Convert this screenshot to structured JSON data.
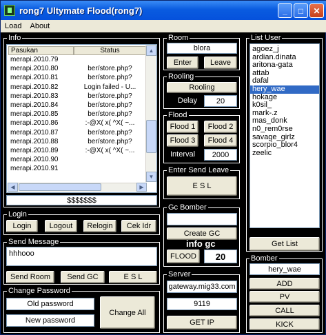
{
  "window": {
    "title": "rong7 Ultymate Flood(rong7)"
  },
  "menu": [
    "Load",
    "About"
  ],
  "info": {
    "label": "Info",
    "columns": [
      "Pasukan",
      "Status"
    ],
    "rows": [
      {
        "pasukan": "merapi.2010.79",
        "status": ""
      },
      {
        "pasukan": "merapi.2010.80",
        "status": "ber/store.php?"
      },
      {
        "pasukan": "merapi.2010.81",
        "status": "ber/store.php?"
      },
      {
        "pasukan": "merapi.2010.82",
        "status": "Login failed - U..."
      },
      {
        "pasukan": "merapi.2010.83",
        "status": "ber/store.php?"
      },
      {
        "pasukan": "merapi.2010.84",
        "status": "ber/store.php?"
      },
      {
        "pasukan": "merapi.2010.85",
        "status": "ber/store.php?"
      },
      {
        "pasukan": "merapi.2010.86",
        "status": ":-@X( x( ^X( ~..."
      },
      {
        "pasukan": "merapi.2010.87",
        "status": "ber/store.php?"
      },
      {
        "pasukan": "merapi.2010.88",
        "status": "ber/store.php?"
      },
      {
        "pasukan": "merapi.2010.89",
        "status": ":-@X( x( ^X( ~..."
      },
      {
        "pasukan": "merapi.2010.90",
        "status": ""
      },
      {
        "pasukan": "merapi.2010.91",
        "status": ""
      }
    ],
    "footer": "$$$$$$$"
  },
  "login": {
    "label": "Login",
    "buttons": [
      "Login",
      "Logout",
      "Relogin",
      "Cek Idr"
    ]
  },
  "send_message": {
    "label": "Send Message",
    "text": "hhhooo",
    "buttons": [
      "Send Room",
      "Send GC",
      "E S L"
    ]
  },
  "change_password": {
    "label": "Change Password",
    "old_placeholder": "Old password",
    "new_placeholder": "New password",
    "change_all": "Change All"
  },
  "room": {
    "label": "Room",
    "value": "blora",
    "enter": "Enter",
    "leave": "Leave"
  },
  "rooling": {
    "label": "Rooling",
    "button": "Rooling",
    "delay_label": "Delay",
    "delay": "20"
  },
  "flood": {
    "label": "Flood",
    "buttons": [
      "Flood 1",
      "Flood 2",
      "Flood 3",
      "Flood 4"
    ],
    "interval_label": "Interval",
    "interval": "2000"
  },
  "esl": {
    "label": "Enter Send Leave",
    "button": "E S L"
  },
  "gc_bomber": {
    "label": "Gc Bomber",
    "create": "Create GC",
    "info": "info gc",
    "flood": "FLOOD",
    "count": "20"
  },
  "server": {
    "label": "Server",
    "host": "gateway.mig33.com",
    "port": "9119",
    "get_ip": "GET IP"
  },
  "list_user": {
    "label": "List User",
    "users": [
      "agoez_j",
      "ardian.dinata",
      "aritona-gata",
      "attab",
      "dafal",
      "hery_wae",
      "hokage",
      "k0sil_",
      "mark-.z",
      "mas_donk",
      "n0_rem0rse",
      "savage_girlz",
      "scorpio_blor4",
      "zeelic"
    ],
    "selected_index": 5,
    "get_list": "Get List"
  },
  "bomber": {
    "label": "Bomber",
    "target": "hery_wae",
    "buttons": [
      "ADD",
      "PV",
      "CALL",
      "KICK"
    ]
  }
}
